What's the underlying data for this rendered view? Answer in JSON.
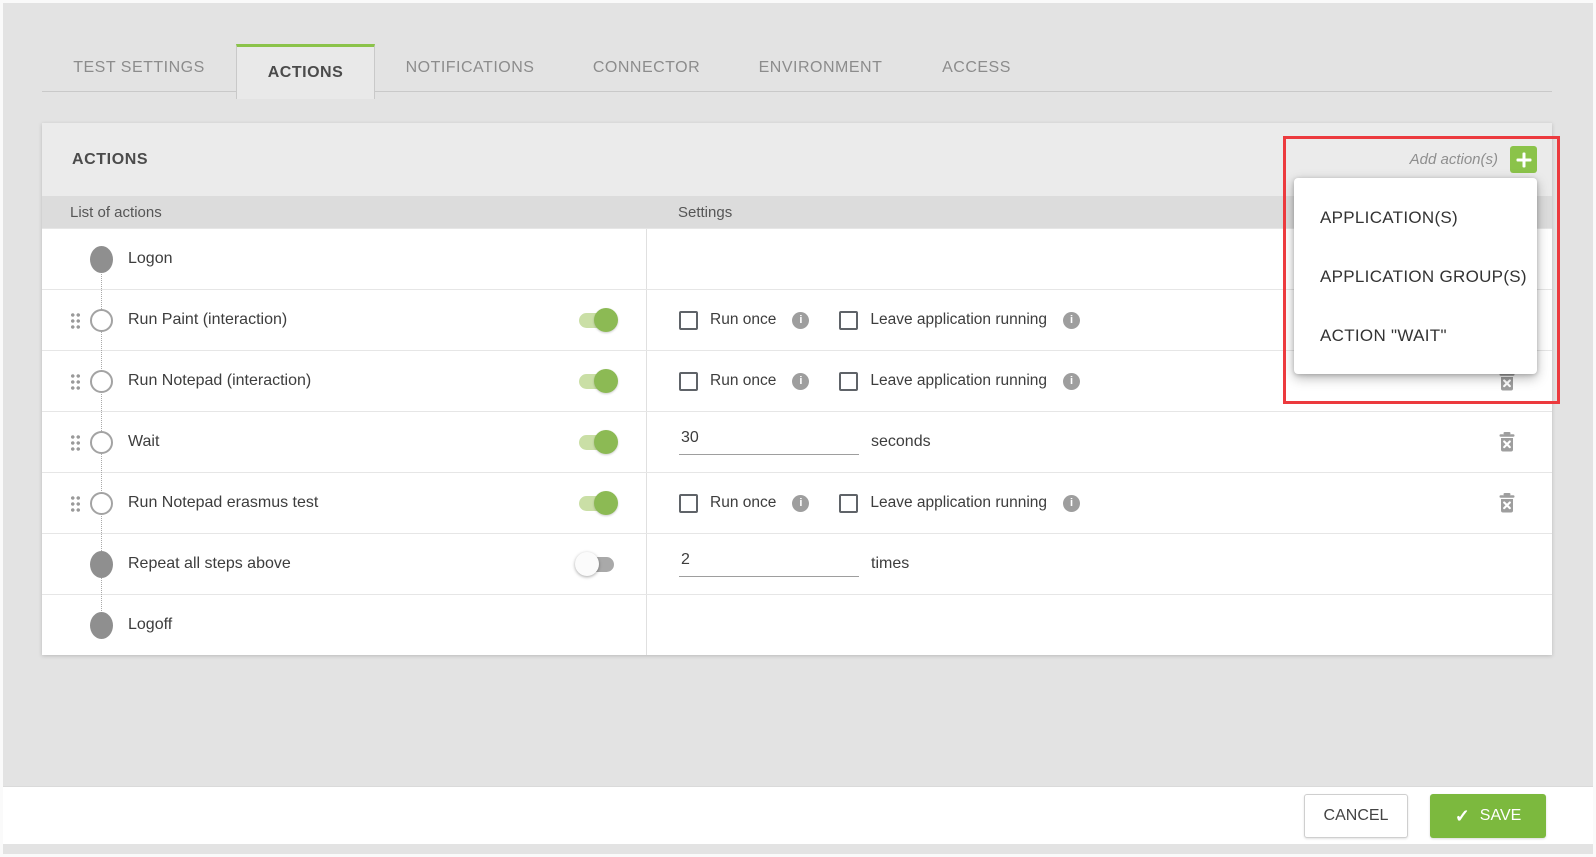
{
  "tabs": [
    {
      "label": "TEST SETTINGS",
      "active": false
    },
    {
      "label": "ACTIONS",
      "active": true
    },
    {
      "label": "NOTIFICATIONS",
      "active": false
    },
    {
      "label": "CONNECTOR",
      "active": false
    },
    {
      "label": "ENVIRONMENT",
      "active": false
    },
    {
      "label": "ACCESS",
      "active": false
    }
  ],
  "panel": {
    "title": "ACTIONS",
    "add_action_label": "Add action(s)"
  },
  "columns": {
    "actions_label": "List of actions",
    "settings_label": "Settings"
  },
  "checkbox_labels": {
    "run_once": "Run once",
    "leave_running": "Leave application running"
  },
  "rows": [
    {
      "label": "Logon",
      "node": "filled",
      "toggle": null
    },
    {
      "label": "Run Paint (interaction)",
      "node": "open",
      "toggle": "on",
      "settings": "checkboxes"
    },
    {
      "label": "Run Notepad (interaction)",
      "node": "open",
      "toggle": "on",
      "settings": "checkboxes"
    },
    {
      "label": "Wait",
      "node": "open",
      "toggle": "on",
      "input": {
        "value": "30",
        "unit": "seconds"
      }
    },
    {
      "label": "Run Notepad erasmus test",
      "node": "open",
      "toggle": "on",
      "settings": "checkboxes"
    },
    {
      "label": "Repeat all steps above",
      "node": "filled",
      "toggle": "off",
      "input": {
        "value": "2",
        "unit": "times"
      }
    },
    {
      "label": "Logoff",
      "node": "filled",
      "toggle": null
    }
  ],
  "add_menu": {
    "items": [
      {
        "label": "APPLICATION(S)"
      },
      {
        "label": "APPLICATION GROUP(S)"
      },
      {
        "label": "ACTION \"WAIT\""
      }
    ]
  },
  "footer": {
    "cancel_label": "CANCEL",
    "save_label": "SAVE"
  },
  "colors": {
    "accent_green": "#8bc34a",
    "save_green": "#7cb93e",
    "annotation_red": "#ec3a3e"
  }
}
